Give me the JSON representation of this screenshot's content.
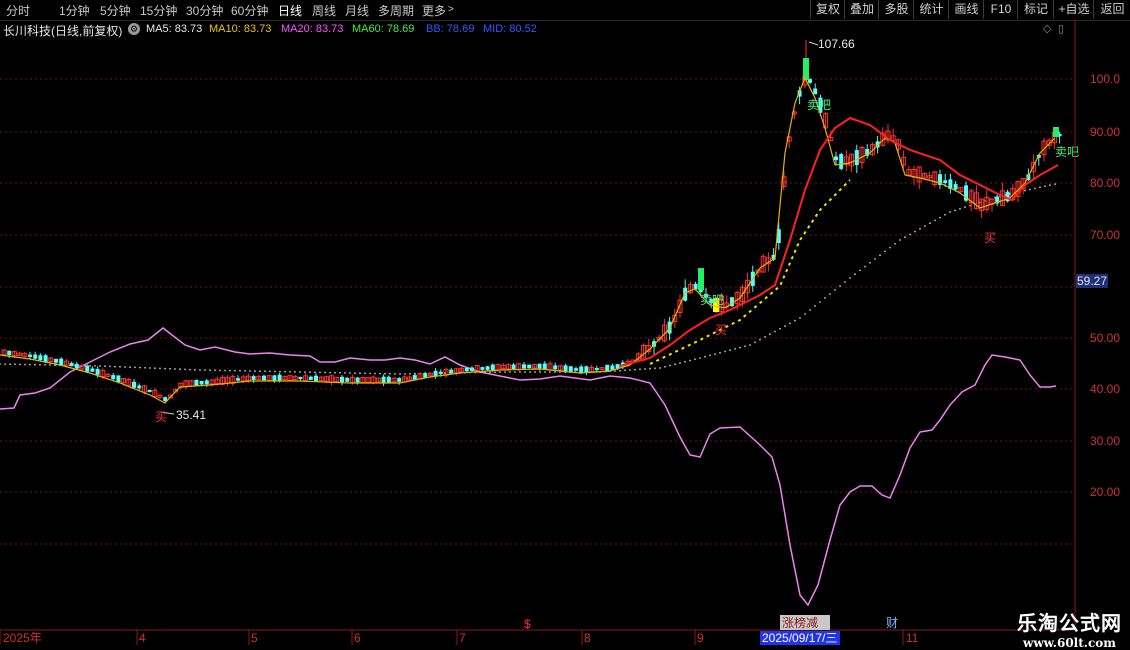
{
  "toolbar": {
    "periods": [
      "分时",
      "1分钟",
      "5分钟",
      "15分钟",
      "30分钟",
      "60分钟",
      "日线",
      "周线",
      "月线",
      "多周期",
      "更多"
    ],
    "active_period": "日线",
    "right_buttons": [
      "复权",
      "叠加",
      "多股",
      "统计",
      "画线",
      "F10",
      "标记",
      "+自选",
      "返回"
    ]
  },
  "stock": {
    "title": "长川科技(日线,前复权)",
    "ma5": "MA5: 83.73",
    "ma10": "MA10: 83.73",
    "ma20": "MA20: 83.73",
    "ma60": "MA60: 78.69",
    "bb": "BB: 78.69",
    "mid": "MID: 80.52"
  },
  "price_axis": {
    "labels": [
      "100.0",
      "90.00",
      "80.00",
      "70.00",
      "50.00",
      "40.00",
      "30.00",
      "20.00"
    ],
    "current_price": "59.27"
  },
  "annotations": {
    "high": "107.66",
    "low": "35.41",
    "signals": [
      "买",
      "卖吧",
      "买",
      "卖吧",
      "T",
      "买",
      "卖吧"
    ]
  },
  "date_axis": {
    "labels": [
      "2025年",
      "4",
      "5",
      "6",
      "7",
      "8",
      "9",
      "11"
    ],
    "cursor_date": "2025/09/17/三",
    "event_tags": [
      "$",
      "涨榜减",
      "财"
    ]
  },
  "watermark": {
    "name": "乐淘公式网",
    "url": "www.60lt.com"
  },
  "colors": {
    "up": "#ff3232",
    "down": "#54ffff",
    "ma": "#e6b400",
    "indicator_line": "#ee82ee",
    "signal_line": "#ff2020",
    "cursor_tag_bg": "#2233ee"
  }
}
